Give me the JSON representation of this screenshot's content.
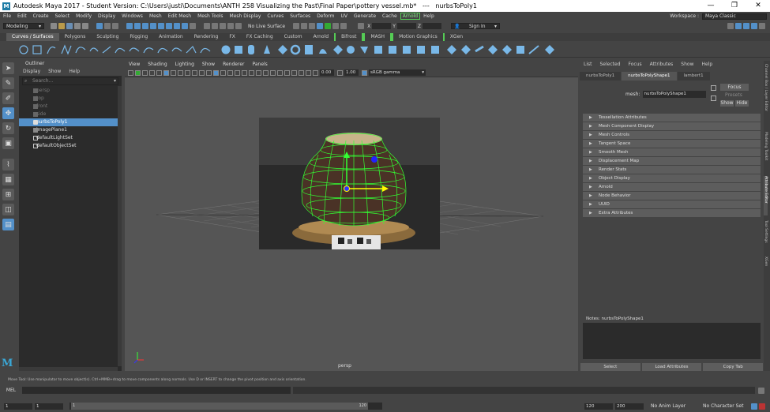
{
  "title": "Autodesk Maya 2017 - Student Version: C:\\Users\\justi\\Documents\\ANTH 258 Visualizing the Past\\Final Paper\\pottery vessel.mb*   ---   nurbsToPoly1",
  "window_controls": [
    "—",
    "❐",
    "✕"
  ],
  "menus": [
    "File",
    "Edit",
    "Create",
    "Select",
    "Modify",
    "Display",
    "Windows",
    "Mesh",
    "Edit Mesh",
    "Mesh Tools",
    "Mesh Display",
    "Curves",
    "Surfaces",
    "Deform",
    "UV",
    "Generate",
    "Cache",
    "Arnold",
    "Help"
  ],
  "workspace_label": "Workspace :",
  "workspace_value": "Maya Classic",
  "mode_menu": "Modeling",
  "no_live_surface": "No Live Surface",
  "sign_in": "Sign In",
  "xyz": {
    "x": "X",
    "y": "Y",
    "z": "Z"
  },
  "shelf_tabs": [
    "Curves / Surfaces",
    "Polygons",
    "Sculpting",
    "Rigging",
    "Animation",
    "Rendering",
    "FX",
    "FX Caching",
    "Custom",
    "Arnold",
    "Bifrost",
    "MASH",
    "Motion Graphics",
    "XGen"
  ],
  "outliner": {
    "title": "Outliner",
    "menu": [
      "Display",
      "Show",
      "Help"
    ],
    "search_placeholder": "Search...",
    "items": [
      {
        "label": "persp",
        "state": "dim"
      },
      {
        "label": "top",
        "state": "dim"
      },
      {
        "label": "front",
        "state": "dim"
      },
      {
        "label": "side",
        "state": "dim"
      },
      {
        "label": "nurbsToPoly1",
        "state": "sel"
      },
      {
        "label": "imagePlane1",
        "state": "normal"
      },
      {
        "label": "defaultLightSet",
        "state": "normal"
      },
      {
        "label": "defaultObjectSet",
        "state": "normal"
      }
    ]
  },
  "viewport": {
    "menu": [
      "View",
      "Shading",
      "Lighting",
      "Show",
      "Renderer",
      "Panels"
    ],
    "val1": "0.00",
    "val2": "1.00",
    "colorspace": "sRGB gamma",
    "camera_label": "persp"
  },
  "ae": {
    "menu": [
      "List",
      "Selected",
      "Focus",
      "Attributes",
      "Show",
      "Help"
    ],
    "tabs": [
      "nurbsToPoly1",
      "nurbsToPolyShape1",
      "lambert1"
    ],
    "mesh_label": "mesh:",
    "mesh_value": "nurbsToPolyShape1",
    "focus": "Focus",
    "presets": "Presets",
    "show": "Show",
    "hide": "Hide",
    "sections": [
      "Tessellation Attributes",
      "Mesh Component Display",
      "Mesh Controls",
      "Tangent Space",
      "Smooth Mesh",
      "Displacement Map",
      "Render Stats",
      "Object Display",
      "Arnold",
      "Node Behavior",
      "UUID",
      "Extra Attributes"
    ],
    "notes": "Notes:  nurbsToPolyShape1",
    "buttons": [
      "Select",
      "Load Attributes",
      "Copy Tab"
    ]
  },
  "right_tabs": [
    "Channel Box / Layer Editor",
    "Modeling Toolkit",
    "Attribute Editor",
    "Tool Settings",
    "XGen"
  ],
  "help_line": "Move Tool: Use manipulator to move object(s). Ctrl+MMB+drag to move components along normals. Use D or INSERT to change the pivot position and axis orientation.",
  "cmd_label": "MEL",
  "timeline": {
    "start": "1",
    "current": "1",
    "slider_start": "1",
    "slider_end": "120",
    "end1": "120",
    "end2": "200",
    "anim_layer": "No Anim Layer",
    "char_set": "No Character Set"
  }
}
